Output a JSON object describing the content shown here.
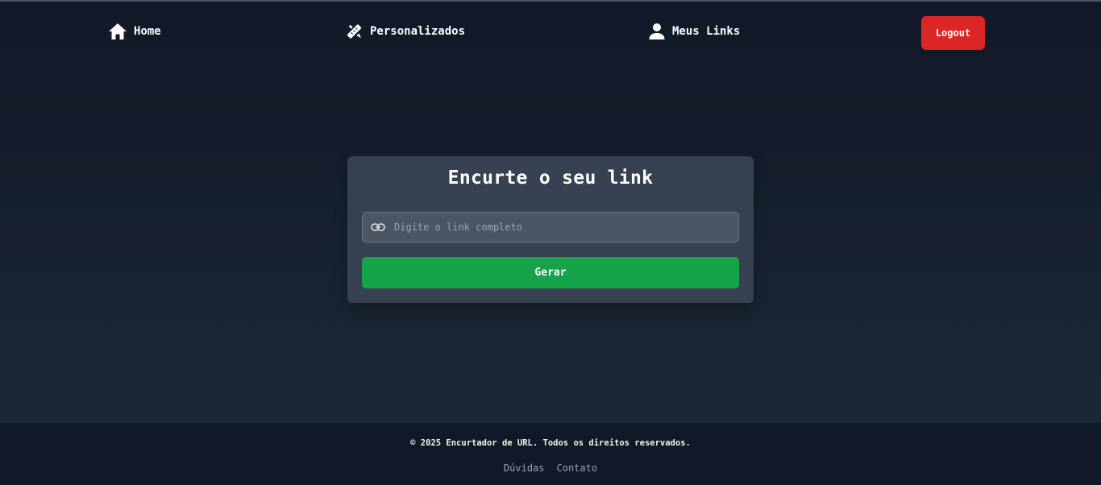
{
  "nav": {
    "home_label": "Home",
    "custom_label": "Personalizados",
    "links_label": "Meus Links",
    "logout_label": "Logout"
  },
  "card": {
    "title": "Encurte o seu link",
    "input_placeholder": "Digite o link completo",
    "input_value": "",
    "submit_label": "Gerar"
  },
  "footer": {
    "copyright": "© 2025 Encurtador de URL. Todos os direitos reservados.",
    "links": [
      "Dúvidas",
      "Contato"
    ]
  },
  "icons": {
    "home": "home-icon",
    "custom": "pencil-ruler-icon",
    "links": "user-icon",
    "url": "link-icon"
  },
  "colors": {
    "logout": "#dc2626",
    "submit": "#16a34a",
    "card": "#374151"
  }
}
